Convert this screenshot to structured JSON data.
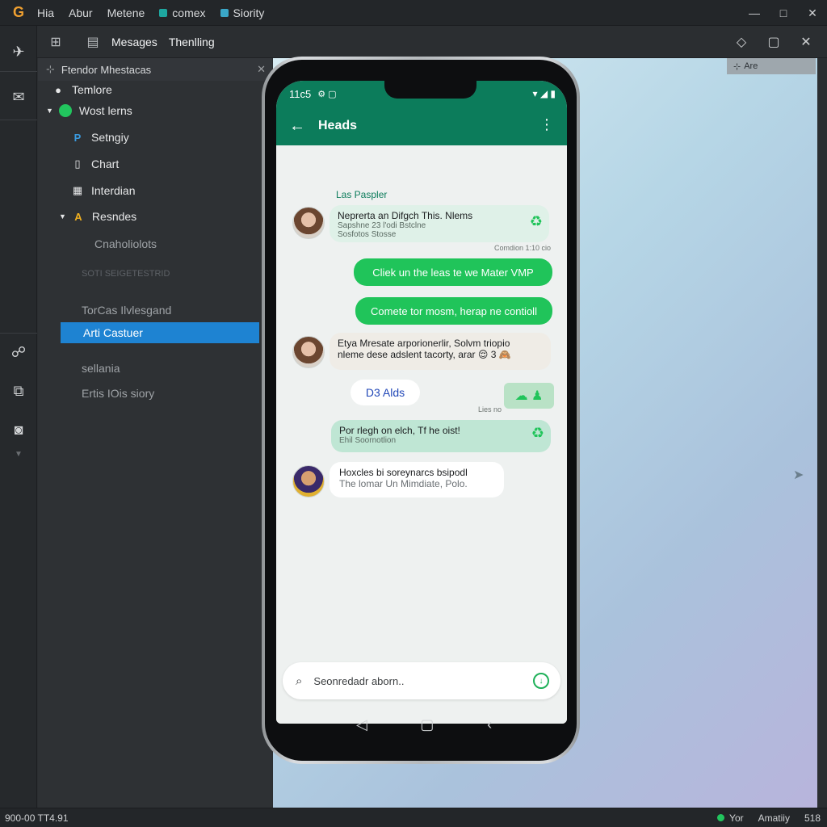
{
  "colors": {
    "accent_green": "#20c45a",
    "header_teal": "#0c7c5b",
    "selection_blue": "#1e83d2",
    "dark_bg": "#2b2e31"
  },
  "titlebar": {
    "app_glyph": "G",
    "menu": [
      "Hia",
      "Abur",
      "Metene"
    ],
    "tabs": [
      {
        "label": "comex",
        "color": "#1ea7a0"
      },
      {
        "label": "Siority",
        "color": "#3aa7c8"
      }
    ],
    "controls": {
      "minimize": "—",
      "maximize": "□",
      "close": "✕"
    }
  },
  "toolbar": {
    "tabs": [
      "Mesages",
      "Thenlling"
    ]
  },
  "sidebar": {
    "header": "Ftendor Mhestacas",
    "items": [
      {
        "label": "Temlore",
        "icon": "dot-icon"
      },
      {
        "label": "Wost lerns",
        "icon": "green-circle-icon"
      },
      {
        "label": "Setngiy",
        "icon": "p-icon"
      },
      {
        "label": "Chart",
        "icon": "file-icon"
      },
      {
        "label": "Interdian",
        "icon": "window-icon"
      },
      {
        "label": "Resndes",
        "icon": "a-icon"
      },
      {
        "label": "Cnaholiolots"
      },
      {
        "label": "SOTI SEIGETESTRID"
      },
      {
        "label": "TorCas Ilvlesgand"
      },
      {
        "label": "Arti Castuer"
      },
      {
        "label": "sellania"
      },
      {
        "label": "Ertis IOis siory"
      }
    ]
  },
  "canvas": {
    "right_tab": "Are"
  },
  "phone": {
    "status_time": "11c5",
    "header_title": "Heads",
    "messages": {
      "sender_name": "Las Paspler",
      "m1_line1": "Neprerta an Difgch This. Nlems",
      "m1_line2": "Sapshne 23 l'odi Bstclne",
      "m1_line3": "Sosfotos Stosse",
      "m1_time": "Comdion 1:10 cio",
      "m2": "Cliek un the leas te we Mater VMP",
      "m3": "Comete tor mosm, herap ne contioll",
      "m4_line1": "Etya Mresate arporionerlir, Solvm triopio",
      "m4_line2": "nleme dese adslent tacorty, arar 😌 3 🙈",
      "chip": "D3 Alds",
      "chip_time": "Lies no",
      "m5_line1": "Por rlegh on elch, Tf he oist!",
      "m5_line2": "Ehil Soornotlion",
      "m6_line1": "Hoxcles bi soreynarcs bsipodl",
      "m6_line2": "The lomar Un Mimdiate, Polo."
    },
    "search_placeholder": "Seonredadr aborn.."
  },
  "statusbar": {
    "left": "900-00 TT4.91",
    "right_label1": "Yor",
    "right_label2": "Amatiiy",
    "right_value": "518"
  }
}
